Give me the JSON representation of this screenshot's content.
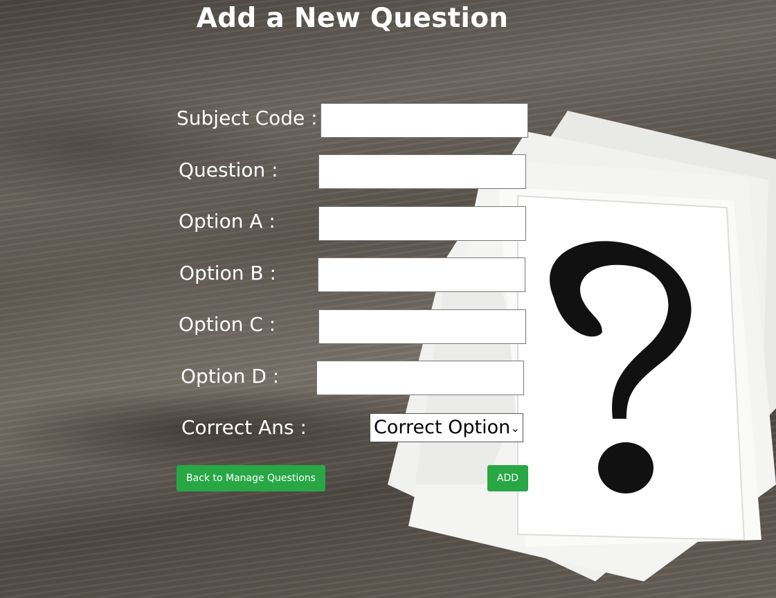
{
  "page": {
    "title": "Add a New Question"
  },
  "form": {
    "subject_code_label": "Subject Code :",
    "subject_code_value": "",
    "question_label": "Question :",
    "question_value": "",
    "option_a_label": "Option A :",
    "option_a_value": "",
    "option_b_label": "Option B :",
    "option_b_value": "",
    "option_c_label": "Option C :",
    "option_c_value": "",
    "option_d_label": "Option D :",
    "option_d_value": "",
    "correct_ans_label": "Correct Ans :",
    "correct_ans_selected": "Correct Option"
  },
  "buttons": {
    "back_label": "Back to Manage Questions",
    "add_label": "ADD"
  },
  "colors": {
    "button_green": "#28a745",
    "text_white": "#ffffff"
  },
  "icons": {
    "select_chevron": "chevron-down-icon",
    "background_decor": "question-mark-cards"
  }
}
